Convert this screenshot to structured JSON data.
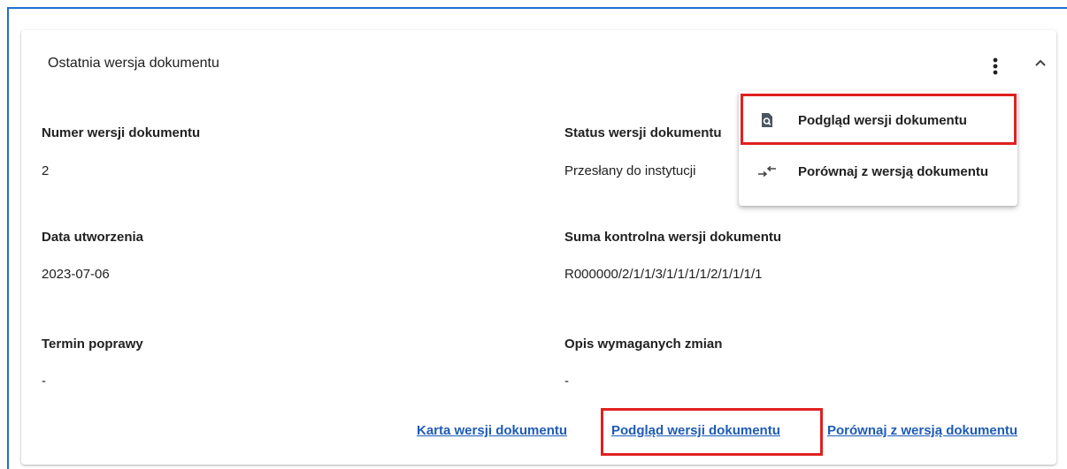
{
  "card": {
    "title": "Ostatnia wersja dokumentu"
  },
  "fields": {
    "numer_label": "Numer wersji dokumentu",
    "numer_value": "2",
    "status_label": "Status wersji dokumentu",
    "status_value": "Przesłany do instytucji",
    "data_label": "Data utworzenia",
    "data_value": "2023-07-06",
    "suma_label": "Suma kontrolna wersji dokumentu",
    "suma_value": "R000000/2/1/1/3/1/1/1/1/2/1/1/1/1",
    "termin_label": "Termin poprawy",
    "termin_value": "-",
    "opis_label": "Opis wymaganych zmian",
    "opis_value": "-"
  },
  "links": {
    "karta": "Karta wersji dokumentu",
    "podglad": "Podgląd wersji dokumentu",
    "porownaj": "Porównaj z wersją dokumentu"
  },
  "menu": {
    "items": [
      {
        "label": "Podgląd wersji dokumentu",
        "icon": "document-preview-icon"
      },
      {
        "label": "Porównaj z wersją dokumentu",
        "icon": "compare-arrows-icon"
      }
    ]
  },
  "icons": {
    "more": "more-vertical-icon",
    "collapse": "chevron-up-icon"
  },
  "colors": {
    "accent_blue": "#1e6fd0",
    "link_blue": "#1e5bb8",
    "highlight_red": "#e02020",
    "preview_icon": "#4a5560"
  }
}
